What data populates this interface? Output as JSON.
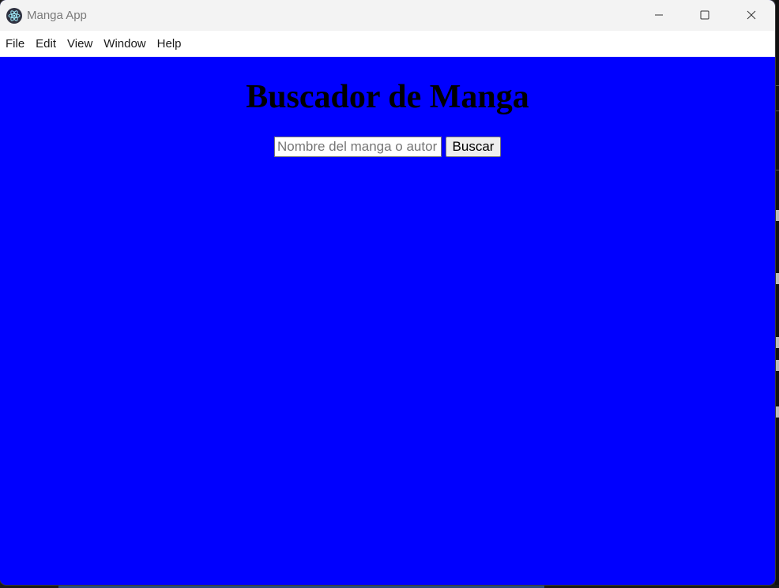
{
  "window": {
    "title": "Manga App"
  },
  "menubar": {
    "items": [
      {
        "label": "File"
      },
      {
        "label": "Edit"
      },
      {
        "label": "View"
      },
      {
        "label": "Window"
      },
      {
        "label": "Help"
      }
    ]
  },
  "main": {
    "heading": "Buscador de Manga",
    "search": {
      "value": "",
      "placeholder": "Nombre del manga o autor",
      "button_label": "Buscar"
    }
  },
  "colors": {
    "content_background": "#0000ff",
    "titlebar_background": "#f3f3f3",
    "menubar_background": "#ffffff"
  },
  "icons": {
    "app": "electron-app-icon",
    "minimize": "minimize-icon",
    "maximize": "maximize-icon",
    "close": "close-icon"
  }
}
